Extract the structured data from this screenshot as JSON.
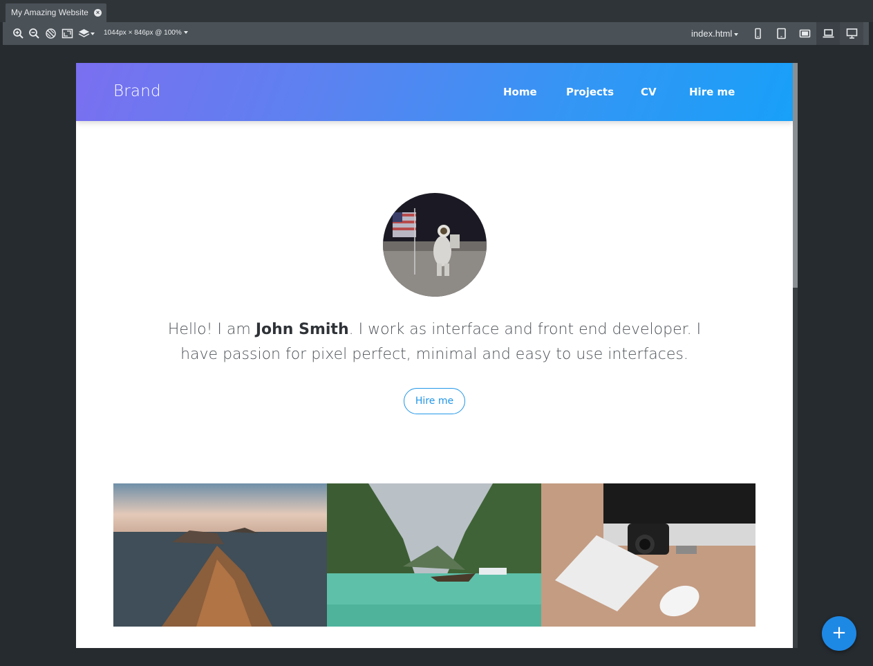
{
  "tab": {
    "title": "My Amazing Website",
    "close_icon": "close-icon"
  },
  "toolbar": {
    "dimensions_label": "1044px × 846px @ 100%",
    "file_name": "index.html",
    "tools": [
      "zoom-in-icon",
      "zoom-out-icon",
      "rotate-icon",
      "resize-icon",
      "layers-icon"
    ],
    "devices": [
      "phone-icon",
      "tablet-icon",
      "tablet-landscape-icon",
      "laptop-icon",
      "desktop-icon"
    ]
  },
  "site": {
    "brand": "Brand",
    "nav": [
      "Home",
      "Projects",
      "CV",
      "Hire me"
    ],
    "intro_before": "Hello! I am ",
    "intro_name": "John Smith",
    "intro_after": ". I work as interface and front end developer. I have passion for pixel perfect, minimal and easy to use interfaces.",
    "hire_button": "Hire me"
  },
  "colors": {
    "gradient_start": "#7a6ff0",
    "gradient_end": "#18a0f8",
    "accent": "#2196e8",
    "fab": "#1e88e5"
  },
  "fab_label": "+"
}
